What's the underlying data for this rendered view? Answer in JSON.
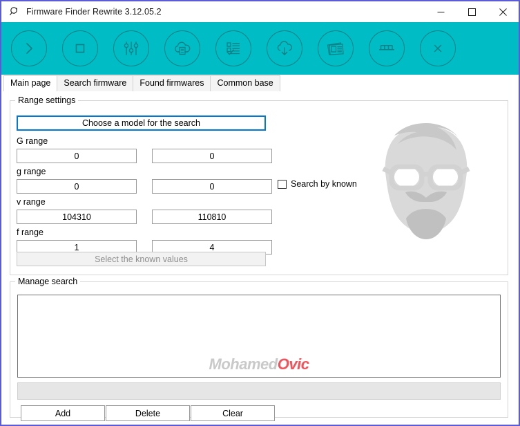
{
  "window": {
    "title": "Firmware Finder Rewrite 3.12.05.2",
    "app_icon": "magnifier-icon",
    "minimize_label": "—",
    "maximize_label": "□",
    "close_label": "✕",
    "border_color": "#5b5bd6"
  },
  "toolbar": {
    "accent_color": "#00bcc5",
    "icon_stroke_color": "#0a7f85",
    "buttons": [
      {
        "name": "start-search-button",
        "icon": "chevron-right-icon"
      },
      {
        "name": "stop-button",
        "icon": "stop-square-icon"
      },
      {
        "name": "settings-sliders-button",
        "icon": "sliders-icon"
      },
      {
        "name": "cloud-document-button",
        "icon": "cloud-document-icon"
      },
      {
        "name": "checklist-button",
        "icon": "checklist-icon"
      },
      {
        "name": "download-button",
        "icon": "cloud-download-icon"
      },
      {
        "name": "news-button",
        "icon": "newspaper-icon"
      },
      {
        "name": "ruler-button",
        "icon": "ruler-icon"
      },
      {
        "name": "exit-button",
        "icon": "close-x-icon"
      }
    ]
  },
  "tabs": {
    "items": [
      {
        "label": "Main page",
        "active": true
      },
      {
        "label": "Search firmware",
        "active": false
      },
      {
        "label": "Found firmwares",
        "active": false
      },
      {
        "label": "Common base",
        "active": false
      }
    ]
  },
  "range_settings": {
    "legend": "Range settings",
    "choose_model_label": "Choose a model for the search",
    "select_known_label": "Select the known values",
    "search_by_known_label": "Search by known",
    "search_by_known_checked": false,
    "rows": [
      {
        "label": "G range",
        "from": "0",
        "to": "0"
      },
      {
        "label": "g range",
        "from": "0",
        "to": "0"
      },
      {
        "label": "v range",
        "from": "104310",
        "to": "110810"
      },
      {
        "label": "f range",
        "from": "1",
        "to": "4"
      }
    ]
  },
  "manage_search": {
    "legend": "Manage search",
    "list_value": "",
    "entry_value": "",
    "add_label": "Add",
    "delete_label": "Delete",
    "clear_label": "Clear"
  },
  "watermark": {
    "text_primary": "Mohamed",
    "text_accent": "Ovic",
    "primary_color": "#c9c9c9",
    "accent_color": "#f4525a",
    "face_icon": "bearded-man-glasses-icon"
  }
}
